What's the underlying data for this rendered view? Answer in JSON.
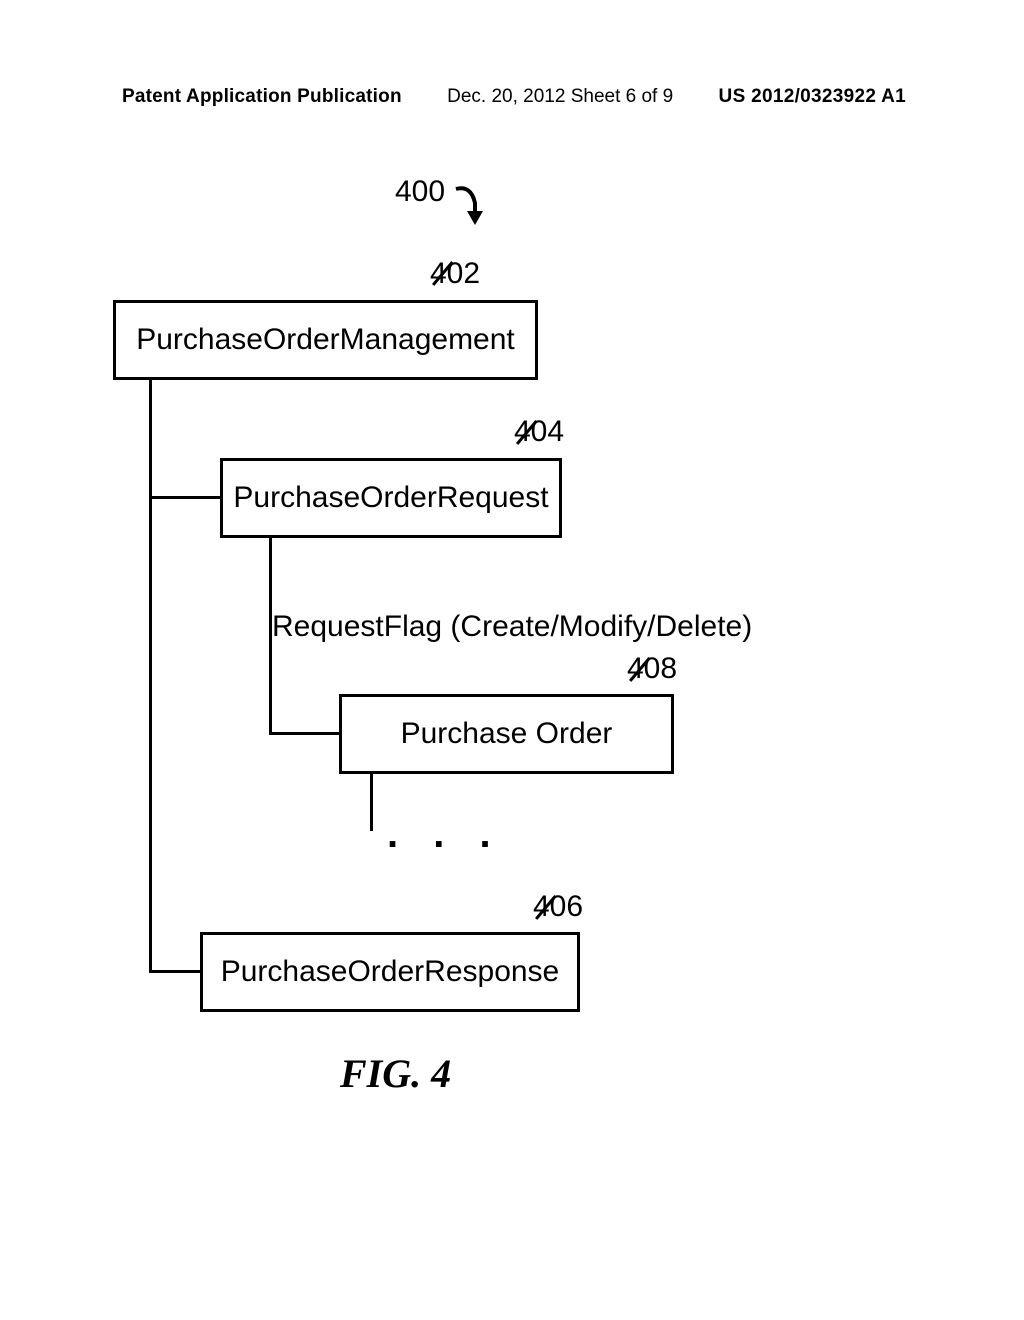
{
  "header": {
    "left": "Patent Application Publication",
    "center": "Dec. 20, 2012  Sheet 6 of 9",
    "right": "US 2012/0323922 A1"
  },
  "labels": {
    "l400": "400",
    "l402": "402",
    "l404": "404",
    "l406": "406",
    "l408": "408"
  },
  "boxes": {
    "b402": "PurchaseOrderManagement",
    "b404": "PurchaseOrderRequest",
    "b408": "Purchase Order",
    "b406": "PurchaseOrderResponse"
  },
  "text": {
    "requestFlag": "RequestFlag (Create/Modify/Delete)",
    "dots": ". . ."
  },
  "caption": "FIG. 4"
}
